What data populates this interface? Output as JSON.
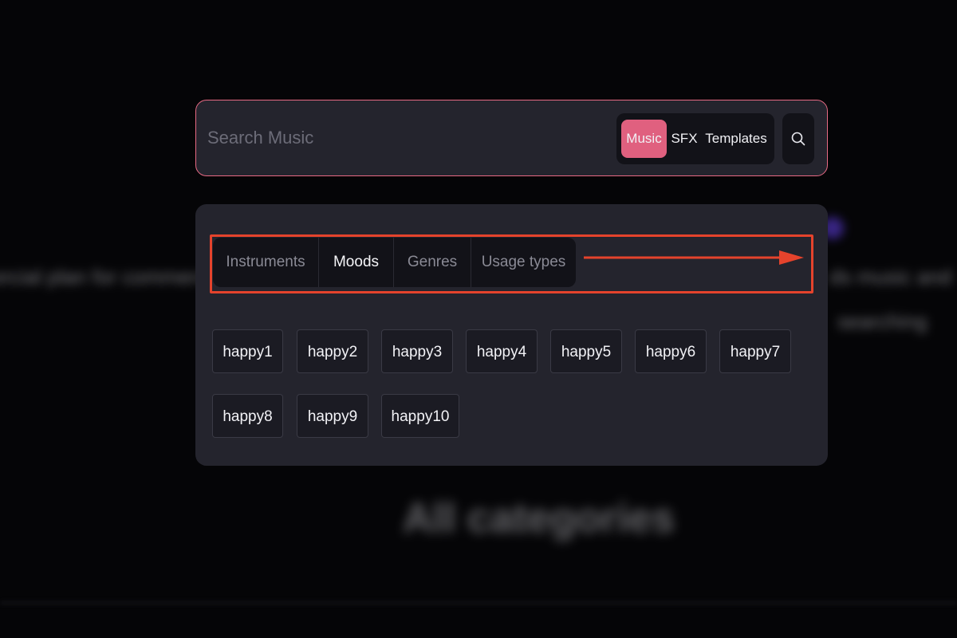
{
  "search": {
    "placeholder": "Search Music",
    "types": [
      "Music",
      "SFX",
      "Templates"
    ],
    "selected_type": "Music",
    "button_icon": "search-icon"
  },
  "panel": {
    "tabs": [
      "Instruments",
      "Moods",
      "Genres",
      "Usage types"
    ],
    "active_tab": "Moods",
    "chips": [
      "happy1",
      "happy2",
      "happy3",
      "happy4",
      "happy5",
      "happy6",
      "happy7",
      "happy8",
      "happy9",
      "happy10"
    ]
  },
  "colors": {
    "accent": "#e0607f",
    "annotation": "#e5432c",
    "panel_bg": "#24242d"
  }
}
